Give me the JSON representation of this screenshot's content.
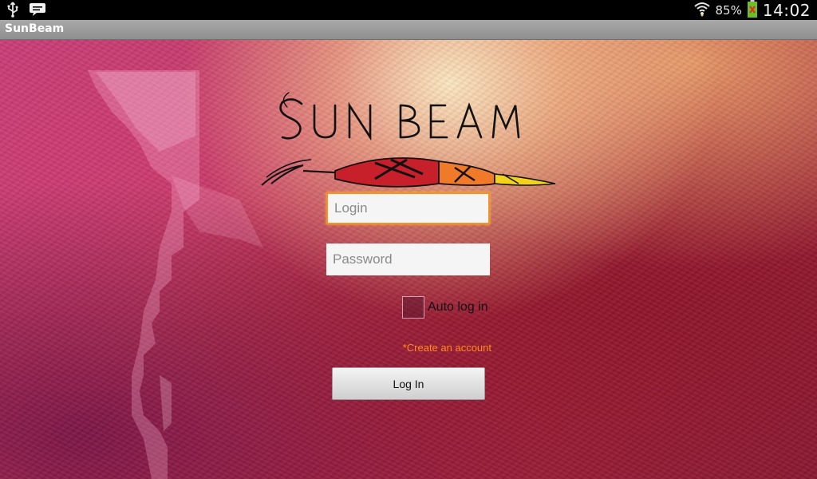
{
  "status_bar": {
    "icons": [
      "usb-icon",
      "message-icon",
      "wifi-icon",
      "battery-icon"
    ],
    "battery_percent": "85%",
    "time": "14:02"
  },
  "app": {
    "title": "SunBeam"
  },
  "logo": {
    "text": "SUN BEAM"
  },
  "form": {
    "login_placeholder": "Login",
    "password_placeholder": "Password",
    "auto_login_label": "Auto log in",
    "auto_login_checked": false,
    "create_account_label": "*Create an account",
    "login_button_label": "Log In"
  },
  "colors": {
    "accent": "#f6921e",
    "link": "#ff8c1a"
  }
}
